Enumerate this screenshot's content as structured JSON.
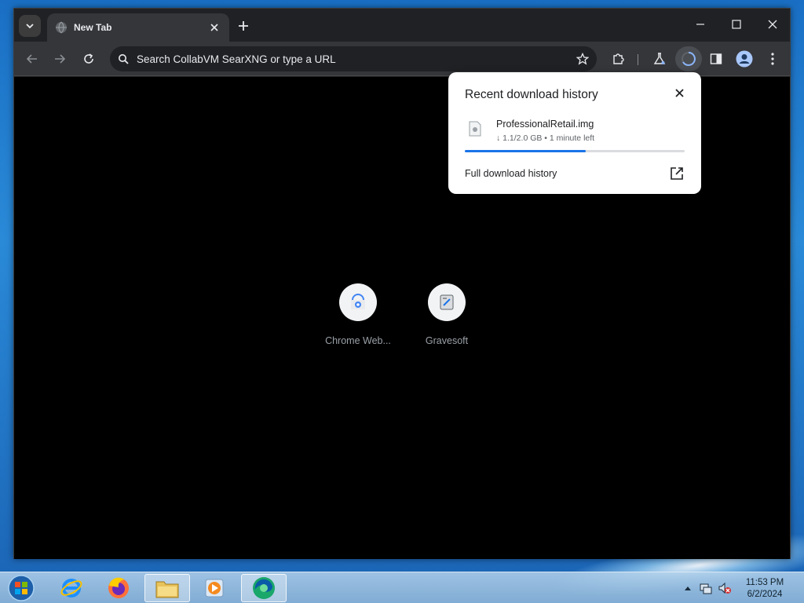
{
  "browser": {
    "tab": {
      "title": "New Tab"
    },
    "omnibox": {
      "text": "Search CollabVM SearXNG or type a URL"
    }
  },
  "shortcuts": [
    {
      "label": "Chrome Web...",
      "icon": "chrome-web-store-icon"
    },
    {
      "label": "Gravesoft",
      "icon": "gravesoft-icon"
    }
  ],
  "download_bubble": {
    "heading": "Recent download history",
    "file": {
      "name": "ProfessionalRetail.img",
      "status": "↓ 1.1/2.0 GB • 1 minute left",
      "progress_fraction": 0.55
    },
    "full_history_label": "Full download history"
  },
  "taskbar": {
    "apps": [
      "internet-explorer-icon",
      "firefox-icon",
      "file-explorer-icon",
      "media-player-icon",
      "edge-icon"
    ],
    "clock": {
      "time": "11:53 PM",
      "date": "6/2/2024"
    }
  },
  "colors": {
    "chrome_dark": "#202124",
    "toolbar": "#35363a",
    "accent": "#1a73e8"
  }
}
